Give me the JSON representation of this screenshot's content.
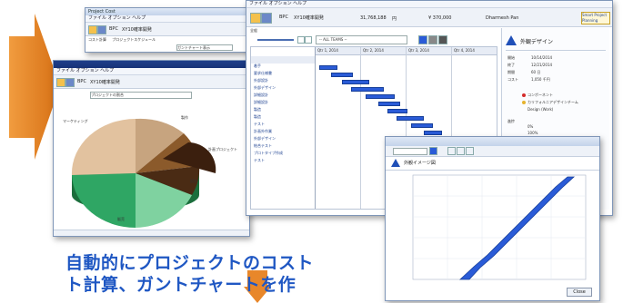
{
  "caption": {
    "line1": "自動的にプロジェクトのコスト",
    "line2": "ト計算、ガントチャートを作"
  },
  "colors": {
    "arrow": "#e8872a",
    "caption": "#1f57c3",
    "bar": "#2a5bd7"
  },
  "back_window": {
    "title": "Project Cost",
    "menu": "ファイル  オプション  ヘルプ",
    "project_name": "XY10確率開発",
    "project_code": "BPC",
    "tab1": "コスト計算",
    "tab2": "プロジェクトスケジュール",
    "dropdown": "ガントチャート表示"
  },
  "pie_window": {
    "menu": "ファイル  オプション  ヘルプ",
    "project_code": "BPC",
    "project_name": "XY10確率開発",
    "filter": "プロジェクトの割合",
    "labels": [
      "マーケティング",
      "製作",
      "計画プロジェクト",
      "設計",
      "販売"
    ]
  },
  "gantt_window": {
    "menu": "ファイル  オプション  ヘルプ",
    "project_code": "BPC",
    "project_name": "XY10確率開発",
    "amount": "31,768,188",
    "amount_unit": "円",
    "cost": "¥ 370,000",
    "manager": "Dharmesh Pan",
    "brand": "Smart Project Planning",
    "tab": "全般",
    "team_filter": "-- ALL TEAMS --",
    "quarters": [
      "Qtr 1, 2014",
      "Qtr 2, 2014",
      "Qtr 3, 2014",
      "Qtr 4, 2014"
    ],
    "tasks": [
      "着手",
      "要求仕様書",
      "外部設計",
      "外部デザイン",
      "詳細設計",
      "詳細設計",
      "製造",
      "製造",
      "テスト",
      "計画外作業",
      "外部デザイン",
      "結合テスト",
      "プロトタイプ作成",
      "テスト"
    ]
  },
  "detail": {
    "title": "外観デザイン",
    "fields": [
      {
        "k": "開始",
        "v": "10/14/2014"
      },
      {
        "k": "終了",
        "v": "12/21/2014"
      },
      {
        "k": "期間",
        "v": "60 日"
      },
      {
        "k": "コスト",
        "v": "1,050 千円"
      }
    ],
    "person1": "コンポーネント",
    "person2": "カリフォルニアデザインチーム",
    "owner": "Design (Work)",
    "progress_label": "進捗",
    "progress": "0%",
    "percent_complete": "100%"
  },
  "chart_window": {
    "title": "外観イメージ図",
    "button": "Close"
  }
}
